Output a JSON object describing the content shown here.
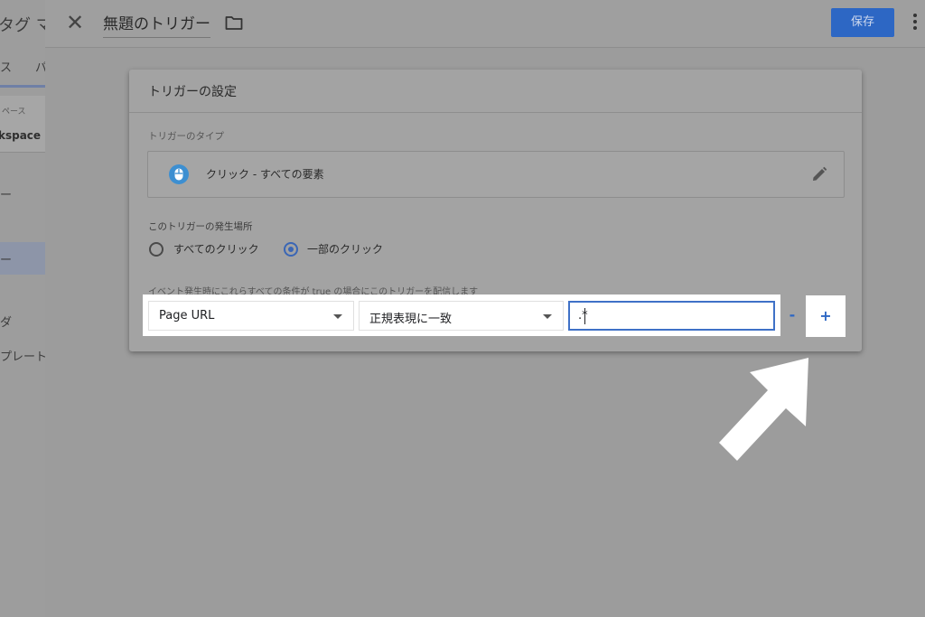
{
  "background_app": {
    "header_partial": "タグ マ",
    "tabs_partial": "ス　　パ",
    "workspace_label_partial": "ペース",
    "workspace_name_partial": "kspace",
    "nav_partial_1": "ー",
    "nav_partial_2_selected": "ー",
    "nav_partial_3": "ダ",
    "nav_partial_4": "プレート"
  },
  "dialog": {
    "title": "無題のトリガー",
    "save_label": "保存"
  },
  "card": {
    "title": "トリガーの設定",
    "type_label": "トリガーのタイプ",
    "type_name": "クリック - すべての要素",
    "where_label": "このトリガーの発生場所",
    "radio_all": "すべてのクリック",
    "radio_some": "一部のクリック",
    "selected_radio": "一部のクリック",
    "condition_label": "イベント発生時にこれらすべての条件が true の場合にこのトリガーを配信します"
  },
  "condition": {
    "variable": "Page URL",
    "operator": "正規表現に一致",
    "value": ".*",
    "remove_label": "-",
    "add_label": "+"
  },
  "colors": {
    "accent": "#2d67c4",
    "input_focus": "#3f71c7",
    "type_icon": "#3d8fd1"
  },
  "icons": [
    "close-icon",
    "folder-icon",
    "more-vert-icon",
    "mouse-icon",
    "pencil-icon"
  ]
}
